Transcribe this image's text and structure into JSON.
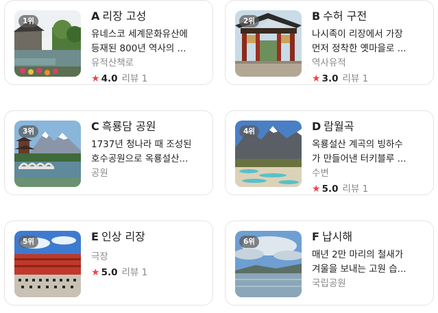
{
  "places": [
    {
      "rank": "1위",
      "letter": "A",
      "name": "리장 고성",
      "desc_lines": [
        "유네스코 세계문화유산에",
        "등재된 800년 역사의 ..."
      ],
      "category": "유적산책로",
      "rating": "4.0",
      "review_label": "리뷰",
      "review_count": "1",
      "thumb_icon": "old-town-icon"
    },
    {
      "rank": "2위",
      "letter": "B",
      "name": "수허 구전",
      "desc_lines": [
        "나시족이 리장에서 가장",
        "먼저 정착한 옛마을로 ..."
      ],
      "category": "역사유적",
      "rating": "3.0",
      "review_label": "리뷰",
      "review_count": "1",
      "thumb_icon": "gate-icon"
    },
    {
      "rank": "3위",
      "letter": "C",
      "name": "흑룡담 공원",
      "desc_lines": [
        "1737년 청나라 때 조성된",
        "호수공원으로 옥룡설산..."
      ],
      "category": "공원",
      "thumb_icon": "lake-park-icon"
    },
    {
      "rank": "4위",
      "letter": "D",
      "name": "람월곡",
      "desc_lines": [
        "옥룡설산 계곡의 빙하수",
        "가 만들어낸 터키블루 ..."
      ],
      "category": "수변",
      "rating": "5.0",
      "review_label": "리뷰",
      "review_count": "1",
      "thumb_icon": "valley-icon"
    },
    {
      "rank": "5위",
      "letter": "E",
      "name": "인상 리장",
      "desc_lines": [],
      "category": "극장",
      "rating": "5.0",
      "review_label": "리뷰",
      "review_count": "1",
      "thumb_icon": "theater-icon"
    },
    {
      "rank": "6위",
      "letter": "F",
      "name": "납시해",
      "desc_lines": [
        "매년 2만 마리의 철새가",
        "겨울을 보내는 고원 습..."
      ],
      "category": "국립공원",
      "thumb_icon": "lake-icon"
    }
  ],
  "star_icon": "star-icon",
  "star_color": "#f04444"
}
